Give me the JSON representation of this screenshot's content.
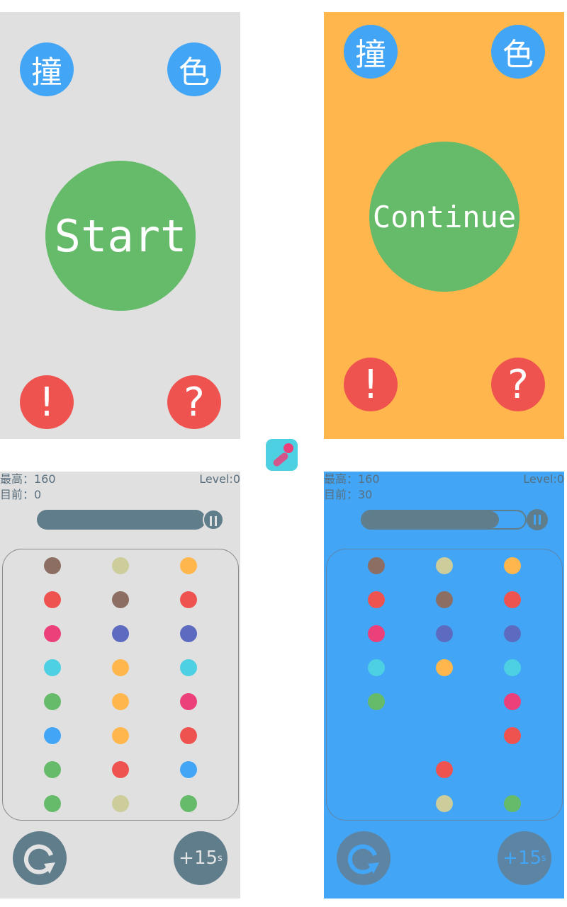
{
  "menu": {
    "left_button": "撞",
    "right_button": "色",
    "start_label": "Start",
    "continue_label": "Continue",
    "info_button": "!",
    "help_button": "?",
    "colors": {
      "light_bg": "#e0e0e0",
      "orange_bg": "#ffb74d",
      "blue": "#42a5f5",
      "green": "#66bb6a",
      "red": "#ef5350"
    }
  },
  "app_icon": {
    "name": "app-icon"
  },
  "game_left": {
    "best_label": "最高：160",
    "current_label": "目前：0",
    "level_label": "Level:0",
    "timer_fraction": 1.0,
    "add_time_label": "+15",
    "add_time_unit": "s",
    "restart_icon": "restart-icon",
    "background": "#e0e0e0",
    "grid": [
      [
        "#8d6e63",
        "#cdcc9b",
        "#ffb74d"
      ],
      [
        "#ef5350",
        "#8d6e63",
        "#ef5350"
      ],
      [
        "#ec407a",
        "#5c6bc0",
        "#5c6bc0"
      ],
      [
        "#4dd0e1",
        "#ffb74d",
        "#4dd0e1"
      ],
      [
        "#66bb6a",
        "#ffb74d",
        "#ec407a"
      ],
      [
        "#42a5f5",
        "#ffb74d",
        "#ef5350"
      ],
      [
        "#66bb6a",
        "#ef5350",
        "#42a5f5"
      ],
      [
        "#66bb6a",
        "#cdcc9b",
        "#66bb6a"
      ]
    ]
  },
  "game_right": {
    "best_label": "最高：160",
    "current_label": "目前：30",
    "level_label": "Level:0",
    "timer_fraction": 0.84,
    "add_time_label": "+15",
    "add_time_unit": "s",
    "restart_icon": "restart-icon",
    "background": "#42a5f5",
    "grid": [
      [
        "#8d6e63",
        "#cdcc9b",
        "#ffb74d"
      ],
      [
        "#ef5350",
        "#8d6e63",
        "#ef5350"
      ],
      [
        "#ec407a",
        "#5c6bc0",
        "#5c6bc0"
      ],
      [
        "#4dd0e1",
        "#ffb74d",
        "#4dd0e1"
      ],
      [
        "#66bb6a",
        null,
        "#ec407a"
      ],
      [
        null,
        null,
        "#ef5350"
      ],
      [
        null,
        "#ef5350",
        null
      ],
      [
        null,
        "#cdcc9b",
        "#66bb6a"
      ]
    ]
  }
}
